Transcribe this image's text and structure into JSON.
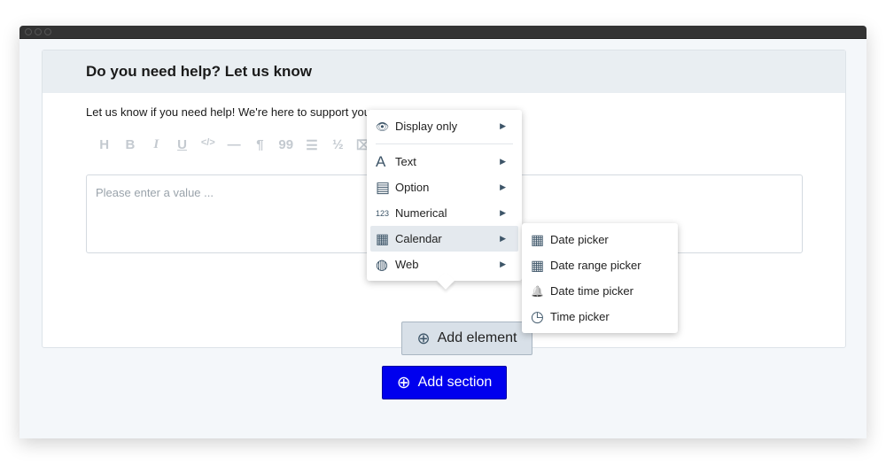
{
  "card": {
    "title": "Do you need help? Let us know",
    "description": "Let us know if you need help! We're here to support you.",
    "placeholder": "Please enter a value ...",
    "toolbar": [
      "H",
      "B",
      "I",
      "U",
      "</>",
      "—",
      "¶",
      "99",
      "☰",
      "½",
      "⌧"
    ]
  },
  "add_element": "Add element",
  "add_section": "Add section",
  "menu": {
    "items": [
      {
        "label": "Display only",
        "icon": "eye-icon",
        "glyph": "👁"
      },
      {
        "label": "Text",
        "icon": "letter-a-icon",
        "glyph": "A"
      },
      {
        "label": "Option",
        "icon": "list-icon",
        "glyph": "▤"
      },
      {
        "label": "Numerical",
        "icon": "numbers-icon",
        "glyph": "123"
      },
      {
        "label": "Calendar",
        "icon": "calendar-icon",
        "glyph": "▦"
      },
      {
        "label": "Web",
        "icon": "globe-icon",
        "glyph": "◍"
      }
    ]
  },
  "submenu": {
    "items": [
      {
        "label": "Date picker",
        "icon": "calendar-icon",
        "glyph": "▦"
      },
      {
        "label": "Date range picker",
        "icon": "calendar-icon",
        "glyph": "▦"
      },
      {
        "label": "Date time picker",
        "icon": "bell-icon",
        "glyph": "🔔"
      },
      {
        "label": "Time picker",
        "icon": "clock-icon",
        "glyph": "◷"
      }
    ]
  },
  "colors": {
    "accent": "#0000ee",
    "menu_icon": "#3d5568"
  }
}
